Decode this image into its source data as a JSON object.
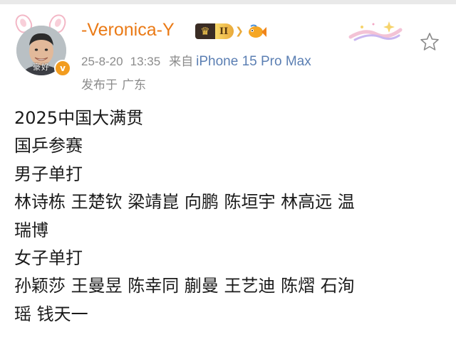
{
  "post": {
    "username": "-Veronica-Y",
    "level_badge": "II",
    "date": "25-8-20",
    "time": "13:35",
    "from_label": "来自",
    "device": "iPhone 15 Pro Max",
    "location_label": "发布于",
    "location": "广东",
    "avatar_caption": "豪好",
    "lines": [
      "2025中国大满贯",
      "国乒参赛",
      "男子单打",
      "林诗栋 王楚钦 梁靖崑 向鹏 陈垣宇 林高远 温",
      "瑞博",
      "女子单打",
      "孙颖莎 王曼昱 陈幸同 蒯曼 王艺迪 陈熠 石洵",
      "瑶 钱天一"
    ]
  },
  "icons": {
    "verified": "verified-badge-icon",
    "crown": "crown-icon",
    "fish": "fish-emoji-icon",
    "decoration": "sparkle-decoration-icon",
    "favorite": "star-outline-icon"
  },
  "colors": {
    "username": "#ea7a16",
    "meta": "#8b8b8b",
    "device": "#5b7fb3",
    "body_text": "#1a1a1a"
  }
}
